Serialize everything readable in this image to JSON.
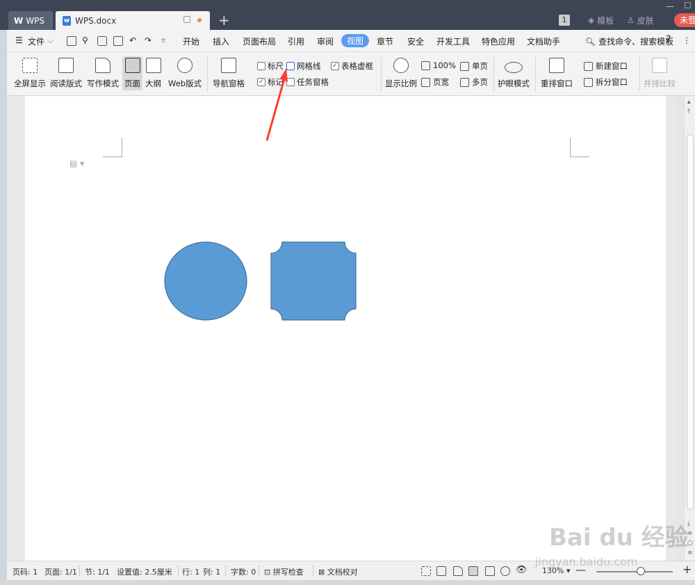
{
  "tabs": {
    "home": "WPS",
    "document": "WPS.docx"
  },
  "titlebar": {
    "badge": "1",
    "template": "模板",
    "skin": "皮肤",
    "login": "未登"
  },
  "menu": {
    "file": "文件",
    "items": [
      "开始",
      "插入",
      "页面布局",
      "引用",
      "审阅",
      "视图",
      "章节",
      "安全",
      "开发工具",
      "特色应用",
      "文档助手"
    ],
    "active": "视图",
    "search": "查找命令、搜索模板",
    "help": "?"
  },
  "ribbon": {
    "fullscreen": "全屏显示",
    "reading": "阅读版式",
    "writing": "写作模式",
    "page": "页面",
    "outline": "大纲",
    "web": "Web版式",
    "nav_pane": "导航窗格",
    "ruler": "标尺",
    "gridlines": "网格线",
    "table_frame": "表格虚框",
    "marks": "标记",
    "task_pane": "任务窗格",
    "zoom": "显示比例",
    "hundred": "100%",
    "single_page": "单页",
    "page_width": "页宽",
    "multi_page": "多页",
    "eye_mode": "护眼模式",
    "rearrange": "重排窗口",
    "new_window": "新建窗口",
    "split_window": "拆分窗口",
    "side_by_side": "并排比较"
  },
  "status": {
    "page_num": "页码: 1",
    "pages": "页面: 1/1",
    "section": "节: 1/1",
    "setting": "设置值: 2.5厘米",
    "row": "行: 1",
    "col": "列: 1",
    "words": "字数: 0",
    "spell": "拼写检查",
    "proof": "文档校对",
    "zoom": "130%"
  },
  "watermark": {
    "brand": "Bai du 经验",
    "url": "jingyan.baidu.com"
  },
  "colors": {
    "titlebar": "#3d4454",
    "accent": "#5a9bf0",
    "shape_fill": "#5b9bd5",
    "shape_stroke": "#41719c",
    "arrow": "#ff3b30"
  }
}
